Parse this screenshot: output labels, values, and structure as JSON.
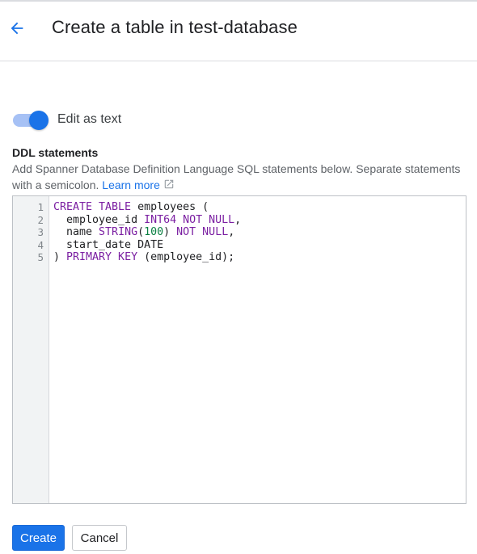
{
  "header": {
    "title": "Create a table in test-database"
  },
  "toggle": {
    "label": "Edit as text",
    "on": true
  },
  "ddl": {
    "heading": "DDL statements",
    "description": "Add Spanner Database Definition Language SQL statements below. Separate statements with a semicolon.",
    "learn_more": "Learn more"
  },
  "editor": {
    "lines": [
      {
        "number": "1",
        "tokens": [
          {
            "t": "kw",
            "v": "CREATE TABLE"
          },
          {
            "t": "plain",
            "v": " employees ("
          }
        ]
      },
      {
        "number": "2",
        "tokens": [
          {
            "t": "plain",
            "v": "  employee_id "
          },
          {
            "t": "kw",
            "v": "INT64 NOT NULL"
          },
          {
            "t": "plain",
            "v": ","
          }
        ]
      },
      {
        "number": "3",
        "tokens": [
          {
            "t": "plain",
            "v": "  name "
          },
          {
            "t": "kw",
            "v": "STRING"
          },
          {
            "t": "plain",
            "v": "("
          },
          {
            "t": "num",
            "v": "100"
          },
          {
            "t": "plain",
            "v": ") "
          },
          {
            "t": "kw",
            "v": "NOT NULL"
          },
          {
            "t": "plain",
            "v": ","
          }
        ]
      },
      {
        "number": "4",
        "tokens": [
          {
            "t": "plain",
            "v": "  start_date DATE"
          }
        ]
      },
      {
        "number": "5",
        "tokens": [
          {
            "t": "plain",
            "v": ") "
          },
          {
            "t": "kw",
            "v": "PRIMARY KEY"
          },
          {
            "t": "plain",
            "v": " (employee_id);"
          }
        ]
      }
    ]
  },
  "footer": {
    "create_label": "Create",
    "cancel_label": "Cancel"
  },
  "colors": {
    "accent": "#1a73e8",
    "keyword": "#7b1fa2",
    "number": "#0b8043"
  },
  "icons": {
    "back": "arrow-left-icon",
    "external": "external-link-icon"
  }
}
